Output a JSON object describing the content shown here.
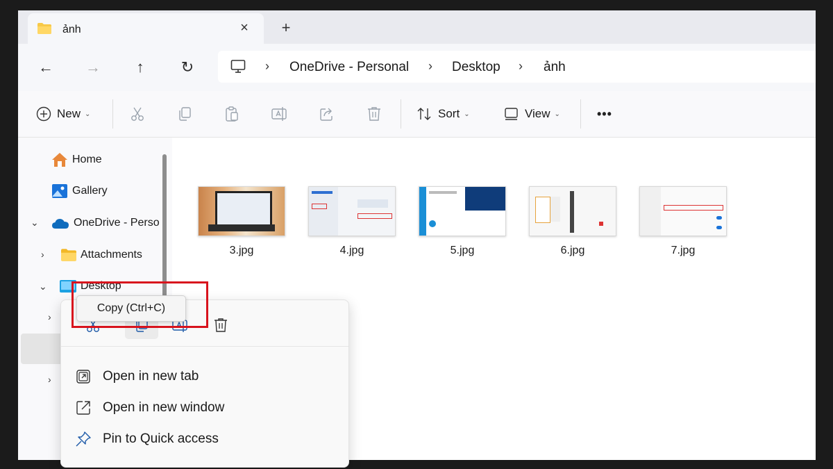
{
  "tab": {
    "title": "ảnh",
    "close": "×",
    "add": "+"
  },
  "nav": {
    "back": "←",
    "forward": "→",
    "up": "↑",
    "refresh": "↻"
  },
  "address": {
    "separator": "›",
    "crumbs": [
      "OneDrive - Personal",
      "Desktop",
      "ảnh"
    ]
  },
  "toolbar": {
    "new_label": "New",
    "sort_label": "Sort",
    "view_label": "View",
    "more": "•••",
    "chevron": "⌄"
  },
  "sidebar": {
    "home": "Home",
    "gallery": "Gallery",
    "onedrive": "OneDrive - Perso",
    "attachments": "Attachments",
    "desktop": "Desktop",
    "expand_glyph": "›",
    "collapse_glyph": "⌄"
  },
  "files": [
    "3.jpg",
    "4.jpg",
    "5.jpg",
    "6.jpg",
    "7.jpg"
  ],
  "tooltip": "Copy (Ctrl+C)",
  "context_menu": {
    "items": [
      "Open in new tab",
      "Open in new window",
      "Pin to Quick access"
    ]
  },
  "colors": {
    "folder": "#f7c948",
    "accent": "#0067c0",
    "highlight": "#d8131d"
  }
}
